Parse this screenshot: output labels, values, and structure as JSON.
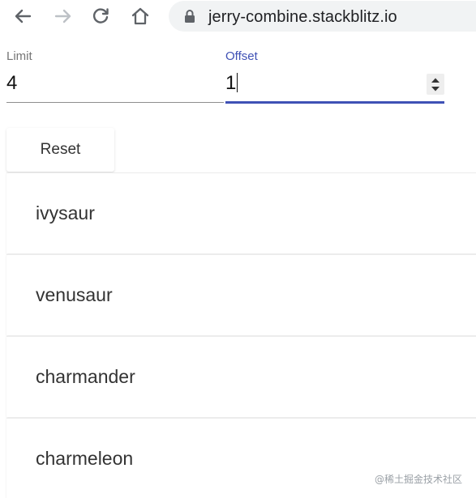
{
  "browser": {
    "url": "jerry-combine.stackblitz.io"
  },
  "form": {
    "limit": {
      "label": "Limit",
      "value": "4"
    },
    "offset": {
      "label": "Offset",
      "value": "1"
    }
  },
  "reset_button": {
    "label": "Reset"
  },
  "list": {
    "items": [
      {
        "label": "ivysaur"
      },
      {
        "label": "venusaur"
      },
      {
        "label": "charmander"
      },
      {
        "label": "charmeleon"
      }
    ]
  },
  "watermark": {
    "text": "@稀土掘金技术社区"
  },
  "colors": {
    "accent": "#3f51b5",
    "label_grey": "#757575",
    "omnibox_bg": "#f1f3f4"
  }
}
